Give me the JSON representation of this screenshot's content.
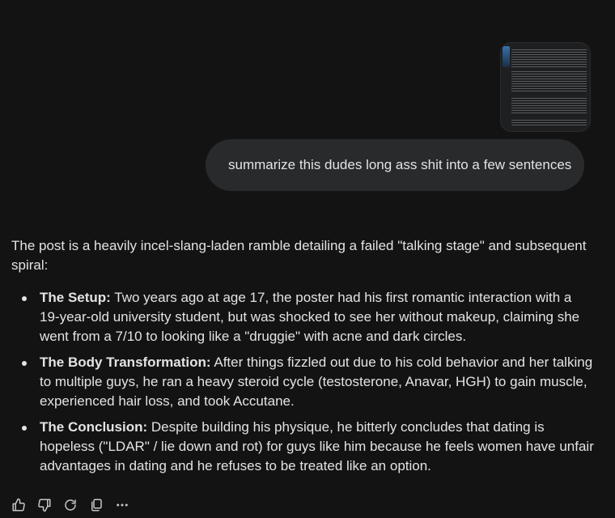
{
  "prompt": {
    "text": "summarize this dudes long ass shit into a few sentences"
  },
  "response": {
    "intro": "The post is a heavily incel-slang-laden ramble detailing a failed \"talking stage\" and subsequent spiral:",
    "bullets": [
      {
        "title": "The Setup:",
        "text": " Two years ago at age 17, the poster had his first romantic interaction with a 19-year-old university student, but was shocked to see her without makeup, claiming she went from a 7/10 to looking like a \"druggie\" with acne and dark circles."
      },
      {
        "title": "The Body Transformation:",
        "text": " After things fizzled out due to his cold behavior and her talking to multiple guys, he ran a heavy steroid cycle (testosterone, Anavar, HGH) to gain muscle, experienced hair loss, and took Accutane."
      },
      {
        "title": "The Conclusion:",
        "text": " Despite building his physique, he bitterly concludes that dating is hopeless (\"LDAR\" / lie down and rot) for guys like him because he feels women have unfair advantages in dating and he refuses to be treated like an option."
      }
    ]
  },
  "actions": [
    {
      "icon": "thumbs-up-icon"
    },
    {
      "icon": "thumbs-down-icon"
    },
    {
      "icon": "redo-icon"
    },
    {
      "icon": "copy-icon"
    },
    {
      "icon": "more-options-icon"
    }
  ],
  "colors": {
    "background": "#131313",
    "bubble": "#282a2c",
    "text": "#e3e3e3",
    "icon": "#c4c7c5"
  }
}
